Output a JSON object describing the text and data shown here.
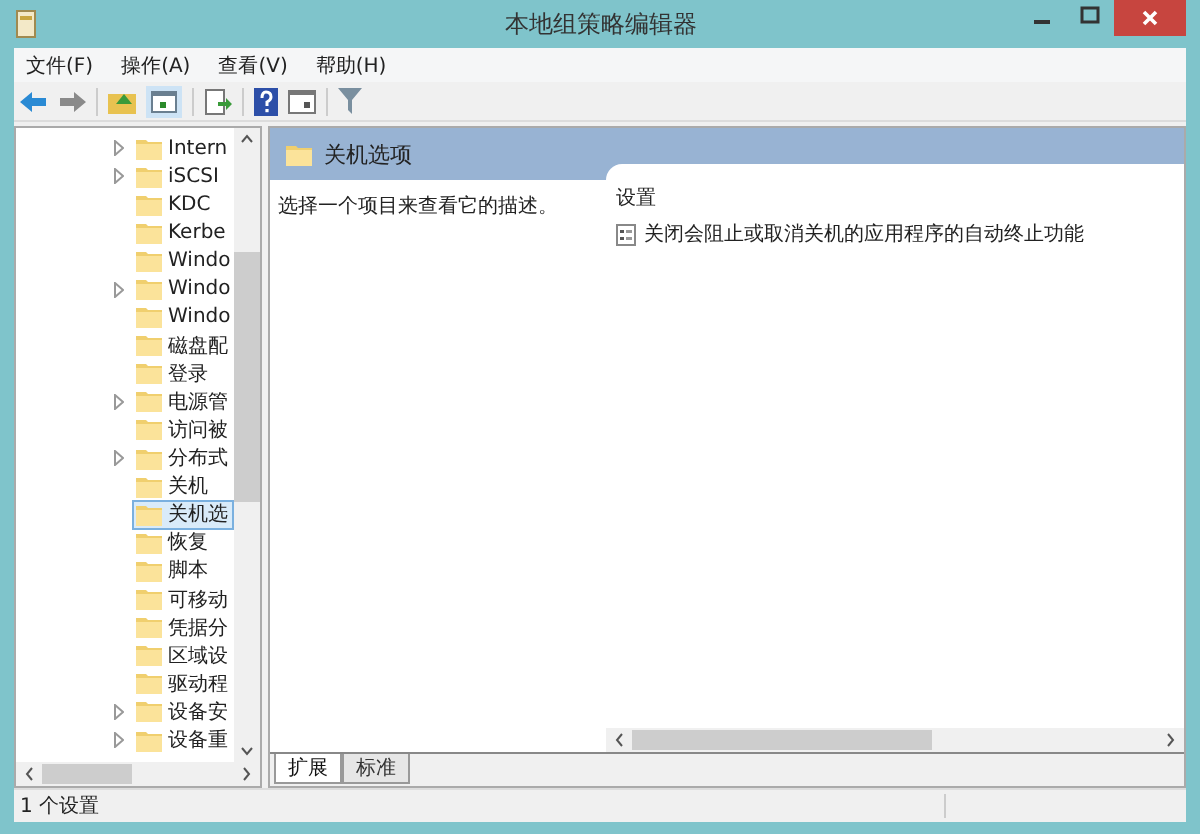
{
  "window": {
    "title": "本地组策略编辑器"
  },
  "menu": [
    "文件(F)",
    "操作(A)",
    "查看(V)",
    "帮助(H)"
  ],
  "tree": {
    "items": [
      {
        "label": "Intern",
        "expandable": true,
        "selected": false
      },
      {
        "label": "iSCSI",
        "expandable": true,
        "selected": false
      },
      {
        "label": "KDC",
        "expandable": false,
        "selected": false
      },
      {
        "label": "Kerbe",
        "expandable": false,
        "selected": false
      },
      {
        "label": "Windo",
        "expandable": false,
        "selected": false
      },
      {
        "label": "Windo",
        "expandable": true,
        "selected": false
      },
      {
        "label": "Windo",
        "expandable": false,
        "selected": false
      },
      {
        "label": "磁盘配",
        "expandable": false,
        "selected": false
      },
      {
        "label": "登录",
        "expandable": false,
        "selected": false
      },
      {
        "label": "电源管",
        "expandable": true,
        "selected": false
      },
      {
        "label": "访问被",
        "expandable": false,
        "selected": false
      },
      {
        "label": "分布式",
        "expandable": true,
        "selected": false
      },
      {
        "label": "关机",
        "expandable": false,
        "selected": false
      },
      {
        "label": "关机选",
        "expandable": false,
        "selected": true
      },
      {
        "label": "恢复",
        "expandable": false,
        "selected": false
      },
      {
        "label": "脚本",
        "expandable": false,
        "selected": false
      },
      {
        "label": "可移动",
        "expandable": false,
        "selected": false
      },
      {
        "label": "凭据分",
        "expandable": false,
        "selected": false
      },
      {
        "label": "区域设",
        "expandable": false,
        "selected": false
      },
      {
        "label": "驱动程",
        "expandable": false,
        "selected": false
      },
      {
        "label": "设备安",
        "expandable": true,
        "selected": false
      },
      {
        "label": "设备重",
        "expandable": true,
        "selected": false
      }
    ]
  },
  "details": {
    "heading": "关机选项",
    "description": "选择一个项目来查看它的描述。",
    "column": "设置",
    "settings": [
      "关闭会阻止或取消关机的应用程序的自动终止功能"
    ]
  },
  "tabs": [
    {
      "label": "扩展",
      "selected": true
    },
    {
      "label": "标准",
      "selected": false
    }
  ],
  "status_bar": "1 个设置"
}
